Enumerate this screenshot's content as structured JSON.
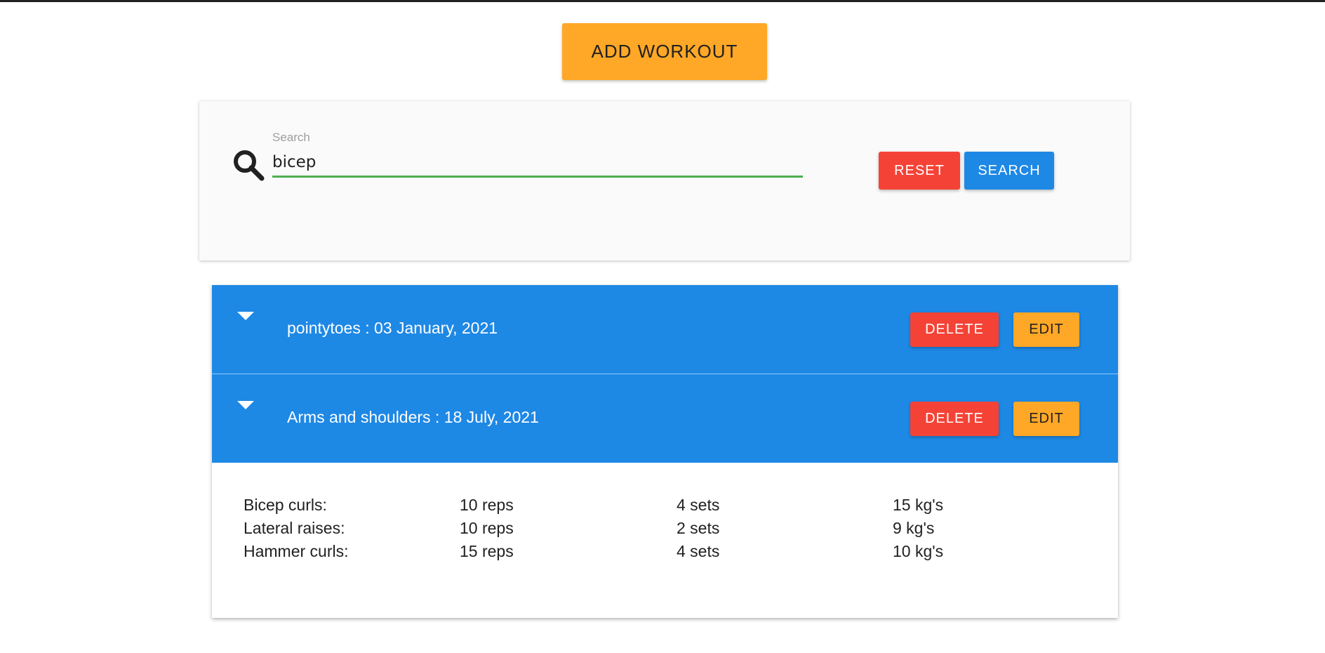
{
  "add_workout_label": "ADD WORKOUT",
  "search": {
    "label": "Search",
    "value": "bicep",
    "reset_label": "RESET",
    "search_label": "SEARCH"
  },
  "workouts": [
    {
      "title": "pointytoes : 03 January, 2021",
      "delete_label": "DELETE",
      "edit_label": "EDIT",
      "expanded": false
    },
    {
      "title": "Arms and shoulders : 18 July, 2021",
      "delete_label": "DELETE",
      "edit_label": "EDIT",
      "expanded": true,
      "exercises": [
        {
          "name": "Bicep curls:",
          "reps": "10 reps",
          "sets": "4 sets",
          "weight": "15 kg's"
        },
        {
          "name": "Lateral raises:",
          "reps": "10 reps",
          "sets": "2 sets",
          "weight": "9 kg's"
        },
        {
          "name": "Hammer curls:",
          "reps": "15 reps",
          "sets": "4 sets",
          "weight": "10 kg's"
        }
      ]
    }
  ],
  "colors": {
    "primary_blue": "#1e88e5",
    "accent_orange": "#ffa726",
    "danger_red": "#f44336",
    "input_green": "#4caf50"
  },
  "icons": {
    "search": "search-icon",
    "expand": "caret-down-icon"
  }
}
